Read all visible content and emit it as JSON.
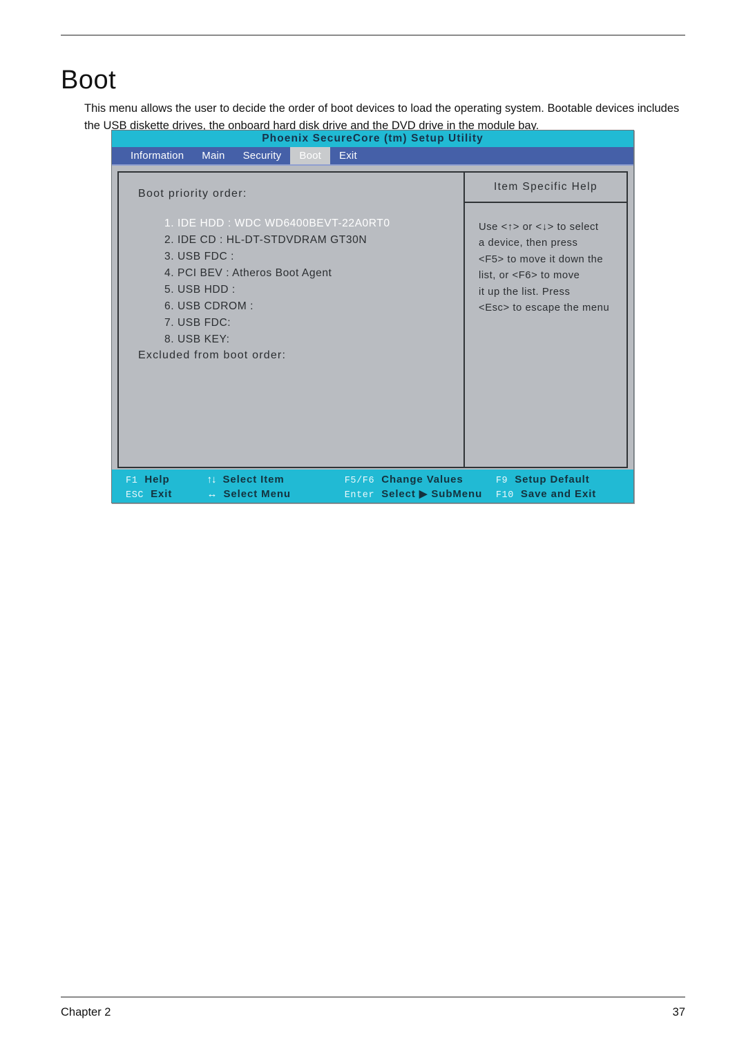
{
  "document": {
    "heading": "Boot",
    "intro": "This menu allows the user to decide the order of boot devices to load the operating system. Bootable devices includes the USB diskette drives, the onboard hard disk drive and the DVD drive in the module bay.",
    "footer_left": "Chapter 2",
    "footer_page": "37"
  },
  "bios": {
    "title": "Phoenix SecureCore (tm) Setup Utility",
    "tabs": [
      {
        "label": "Information",
        "active": false
      },
      {
        "label": "Main",
        "active": false
      },
      {
        "label": "Security",
        "active": false
      },
      {
        "label": "Boot",
        "active": true
      },
      {
        "label": "Exit",
        "active": false
      }
    ],
    "main": {
      "priority_label": "Boot priority order:",
      "items": [
        {
          "text": "1. IDE HDD : WDC WD6400BEVT-22A0RT0",
          "selected": true
        },
        {
          "text": "2. IDE CD : HL-DT-STDVDRAM GT30N",
          "selected": false
        },
        {
          "text": "3. USB FDC :",
          "selected": false
        },
        {
          "text": "4. PCI BEV : Atheros Boot Agent",
          "selected": false
        },
        {
          "text": "5. USB HDD :",
          "selected": false
        },
        {
          "text": "6. USB CDROM :",
          "selected": false
        },
        {
          "text": "7. USB FDC:",
          "selected": false
        },
        {
          "text": "8. USB KEY:",
          "selected": false
        }
      ],
      "excluded_label": "Excluded from boot order:"
    },
    "help": {
      "title": "Item Specific Help",
      "lines": [
        "Use <↑> or <↓> to select",
        "a device, then press",
        "<F5> to move it down the",
        "list, or <F6> to move",
        "it up the list. Press",
        "<Esc> to escape the menu"
      ]
    },
    "keys": {
      "row1": [
        {
          "name": "F1",
          "glyph": "",
          "desc": "Help"
        },
        {
          "name": "",
          "glyph": "↑↓",
          "desc": "Select Item"
        },
        {
          "name": "F5/F6",
          "glyph": "",
          "desc": "Change Values"
        },
        {
          "name": "F9",
          "glyph": "",
          "desc": "Setup Default"
        }
      ],
      "row2": [
        {
          "name": "ESC",
          "glyph": "",
          "desc": "Exit"
        },
        {
          "name": "",
          "glyph": "↔",
          "desc": "Select Menu"
        },
        {
          "name": "Enter",
          "glyph": "",
          "desc": "Select ▶ SubMenu"
        },
        {
          "name": "F10",
          "glyph": "",
          "desc": "Save and Exit"
        }
      ]
    },
    "colors": {
      "title_bar": "#21bad4",
      "tab_bar": "#4560a8",
      "active_tab": "#c9cbcd",
      "panel_bg": "#b9bcc1",
      "key_bar": "#21bad4",
      "selected_item_text": "#ffffff"
    }
  }
}
